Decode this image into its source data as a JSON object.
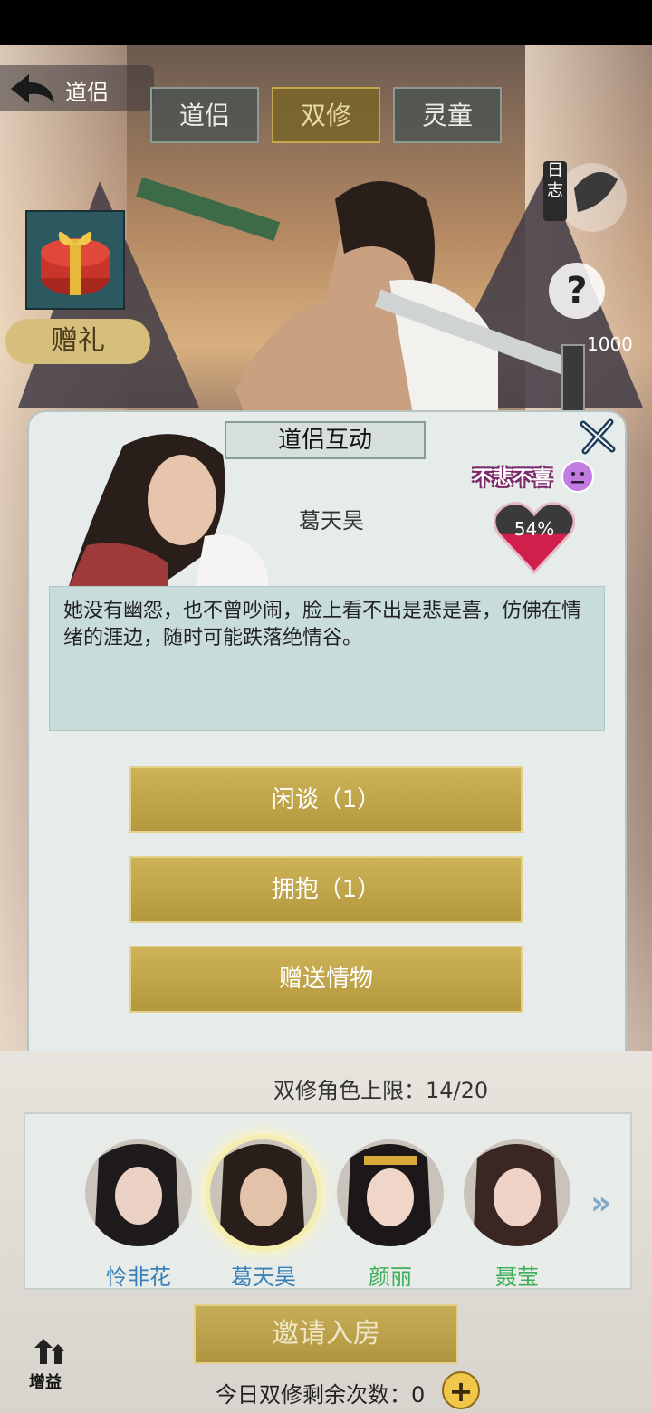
{
  "header": {
    "title": "道侣",
    "tabs": [
      {
        "label": "道侣",
        "active": false
      },
      {
        "label": "双修",
        "active": true
      },
      {
        "label": "灵童",
        "active": false
      }
    ]
  },
  "side": {
    "gift_label": "赠礼",
    "log_label": "日志",
    "help_label": "?",
    "number": "1000"
  },
  "modal": {
    "title": "道侣互动",
    "character_name": "葛天昊",
    "mood": "不悲不喜",
    "affection": "54%",
    "affection_value": 0.54,
    "description": "她没有幽怨，也不曾吵闹，脸上看不出是悲是喜，仿佛在情绪的涯边，随时可能跌落绝情谷。",
    "actions": [
      {
        "label": "闲谈（1）"
      },
      {
        "label": "拥抱（1）"
      },
      {
        "label": "赠送情物"
      }
    ]
  },
  "bottom": {
    "limit_text": "双修角色上限：14/20",
    "roster": [
      {
        "name": "怜非花",
        "color": "#3a7fb8",
        "selected": false
      },
      {
        "name": "葛天昊",
        "color": "#3a7fb8",
        "selected": true
      },
      {
        "name": "颜丽",
        "color": "#3fae5a",
        "selected": false
      },
      {
        "name": "聂莹",
        "color": "#3fae5a",
        "selected": false
      }
    ],
    "invite_label": "邀请入房",
    "buff_label": "增益",
    "remaining_text": "今日双修剩余次数：0",
    "plus_label": "+"
  },
  "icons": {
    "back": "back-arrow-icon",
    "close": "close-icon",
    "mood": "neutral-face-icon",
    "heart": "heart-icon",
    "more": "double-chevron-right-icon"
  }
}
